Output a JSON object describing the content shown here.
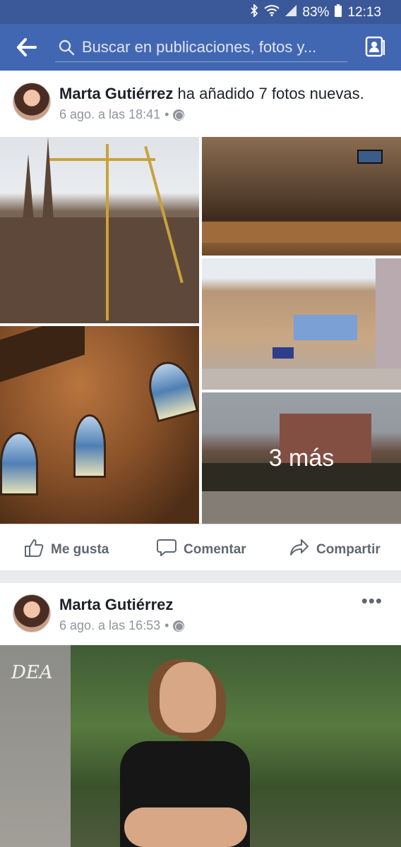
{
  "status_bar": {
    "battery": "83%",
    "time": "12:13"
  },
  "app_bar": {
    "search_placeholder": "Buscar en publicaciones, fotos y..."
  },
  "posts": [
    {
      "author": "Marta Gutiérrez",
      "action_text": "ha añadido 7 fotos nuevas.",
      "time": "6 ago. a las 18:41",
      "more_photos_label": "3 más",
      "actions": {
        "like": "Me gusta",
        "comment": "Comentar",
        "share": "Compartir"
      }
    },
    {
      "author": "Marta Gutiérrez",
      "time": "6 ago. a las 16:53",
      "photo_graffiti": "DEA"
    }
  ],
  "colors": {
    "brand_blue": "#4267b2",
    "status_blue": "#3b5998",
    "action_gray": "#606770"
  },
  "icons": [
    "bluetooth-icon",
    "wifi-icon",
    "signal-icon",
    "battery-icon",
    "back-arrow-icon",
    "search-icon",
    "profile-icon",
    "globe-icon",
    "like-icon",
    "comment-icon",
    "share-icon",
    "more-options-icon"
  ]
}
